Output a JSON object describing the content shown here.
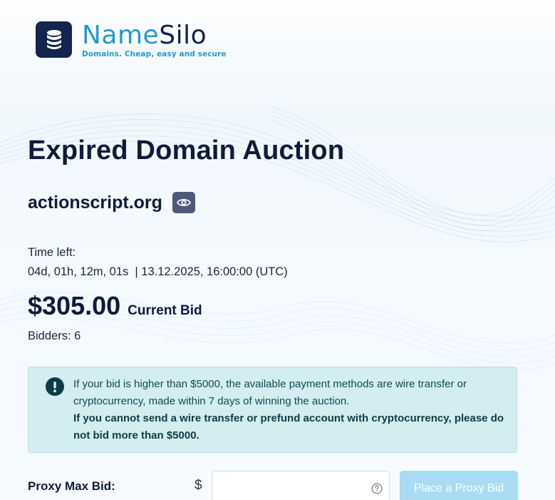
{
  "brand": {
    "name_part_1": "Name",
    "name_part_2": "Silo",
    "tagline": "Domains. Cheap, easy and secure",
    "colors": {
      "navy": "#13244f",
      "blue": "#1f9ad6"
    },
    "icon": "database-stack-icon"
  },
  "auction": {
    "title": "Expired Domain Auction",
    "domain": "actionscript.org",
    "watch_icon": "eye-icon",
    "time_left_label": "Time left:",
    "time_left_value": "04d, 01h, 12m, 01s  | 13.12.2025, 16:00:00 (UTC)",
    "current_bid_amount": "$305.00",
    "current_bid_label": "Current Bid",
    "bidders": "Bidders: 6"
  },
  "alert": {
    "icon": "exclamation-circle-icon",
    "message": "If your bid is higher than $5000, the available payment methods are wire transfer or cryptocurrency, made within 7 days of winning the auction.",
    "warning": "If you cannot send a wire transfer or prefund account with cryptocurrency, please do not bid more than $5000.",
    "colors": {
      "background": "#d4edf0",
      "text": "#0d4a52"
    }
  },
  "proxy_bid": {
    "label": "Proxy Max Bid:",
    "currency": "$",
    "input_value": "",
    "help_icon": "question-circle-icon",
    "button_label": "Place a Proxy Bid",
    "button_color": "#a9dcf3"
  }
}
